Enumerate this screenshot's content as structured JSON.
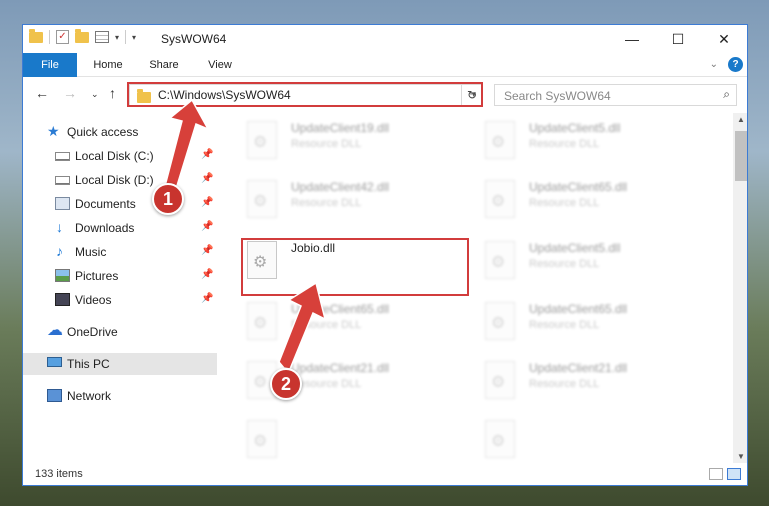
{
  "window": {
    "title": "SysWOW64",
    "controls": {
      "minimize": "—",
      "maximize": "☐",
      "close": "✕"
    }
  },
  "ribbon": {
    "tabs": [
      "File",
      "Home",
      "Share",
      "View"
    ],
    "help": "?"
  },
  "nav": {
    "back": "←",
    "forward": "→",
    "recent": "⌄",
    "up": "↑"
  },
  "address": {
    "path": "C:\\Windows\\SysWOW64",
    "refresh": "↻"
  },
  "search": {
    "placeholder": "Search SysWOW64",
    "icon": "⌕"
  },
  "sidebar": {
    "items": [
      {
        "label": "Quick access",
        "icon": "star-icon"
      },
      {
        "label": "Local Disk (C:)",
        "icon": "drive-icon",
        "pinned": true
      },
      {
        "label": "Local Disk (D:)",
        "icon": "drive-icon",
        "pinned": true
      },
      {
        "label": "Documents",
        "icon": "documents-icon",
        "pinned": true
      },
      {
        "label": "Downloads",
        "icon": "download-icon",
        "pinned": true
      },
      {
        "label": "Music",
        "icon": "music-icon",
        "pinned": true
      },
      {
        "label": "Pictures",
        "icon": "pictures-icon",
        "pinned": true
      },
      {
        "label": "Videos",
        "icon": "videos-icon",
        "pinned": true
      },
      {
        "label": "OneDrive",
        "icon": "cloud-icon"
      },
      {
        "label": "This PC",
        "icon": "computer-icon",
        "selected": true
      },
      {
        "label": "Network",
        "icon": "network-icon"
      }
    ]
  },
  "files": [
    {
      "name": "UpdateClient19.dll",
      "type": "Resource DLL"
    },
    {
      "name": "UpdateClient5.dll",
      "type": "Resource DLL"
    },
    {
      "name": "UpdateClient42.dll",
      "type": "Resource DLL"
    },
    {
      "name": "UpdateClient65.dll",
      "type": "Resource DLL"
    },
    {
      "name": "Jobio.dll",
      "type": ""
    },
    {
      "name": "UpdateClient5.dll",
      "type": "Resource DLL"
    },
    {
      "name": "UpdateClient65.dll",
      "type": "Resource DLL"
    },
    {
      "name": "UpdateClient65.dll",
      "type": "Resource DLL"
    },
    {
      "name": "UpdateClient21.dll",
      "type": "Resource DLL"
    },
    {
      "name": "UpdateClient21.dll",
      "type": "Resource DLL"
    },
    {
      "name": "",
      "type": ""
    },
    {
      "name": "",
      "type": ""
    }
  ],
  "status": {
    "item_count": "133 items"
  },
  "markers": [
    "1",
    "2"
  ],
  "colors": {
    "accent": "#1979ca",
    "highlight": "#d23c3c"
  }
}
